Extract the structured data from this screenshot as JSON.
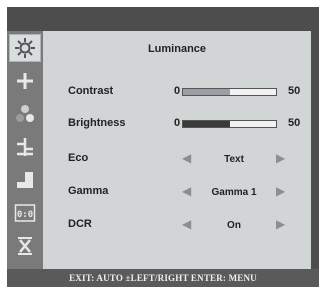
{
  "title": "Luminance",
  "contrast": {
    "label": "Contrast",
    "min": "0",
    "max": "50",
    "level": 0.5
  },
  "brightness": {
    "label": "Brightness",
    "min": "0",
    "max": "50",
    "level": 0.5
  },
  "eco": {
    "label": "Eco",
    "value": "Text"
  },
  "gamma": {
    "label": "Gamma",
    "value": "Gamma 1"
  },
  "dcr": {
    "label": "DCR",
    "value": "On"
  },
  "footer": {
    "text": "EXIT: AUTO  ±LEFT/RIGHT  ENTER: MENU"
  },
  "tab_icons": [
    "luminance-icon",
    "image-setup-icon",
    "color-temp-icon",
    "image-boost-icon",
    "osd-setup-icon",
    "extra-icon",
    "reset-icon"
  ],
  "colors": {
    "contrast_fill": "#9aa0a3",
    "brightness_fill": "#3a3a3a"
  }
}
